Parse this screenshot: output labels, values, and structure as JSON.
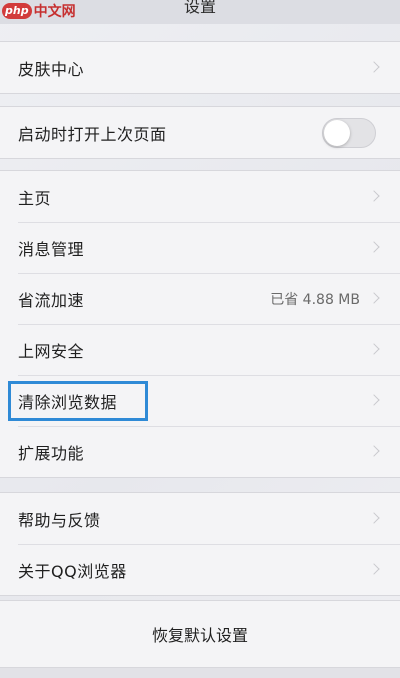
{
  "watermark": {
    "logo_text": "php",
    "site_name": "中文网"
  },
  "navbar": {
    "title": "设置"
  },
  "groups": {
    "skin": {
      "items": [
        {
          "label": "皮肤中心"
        }
      ]
    },
    "startup": {
      "items": [
        {
          "label": "启动时打开上次页面",
          "toggle_on": false
        }
      ]
    },
    "main": {
      "items": [
        {
          "label": "主页"
        },
        {
          "label": "消息管理"
        },
        {
          "label": "省流加速",
          "value": "已省 4.88 MB"
        },
        {
          "label": "上网安全"
        },
        {
          "label": "清除浏览数据"
        },
        {
          "label": "扩展功能"
        }
      ]
    },
    "help": {
      "items": [
        {
          "label": "帮助与反馈"
        },
        {
          "label": "关于QQ浏览器"
        }
      ]
    },
    "reset": {
      "label": "恢复默认设置"
    }
  },
  "colors": {
    "highlight": "#2f8ad6",
    "background": "#ececf0",
    "group_background": "#f4f4f6"
  }
}
